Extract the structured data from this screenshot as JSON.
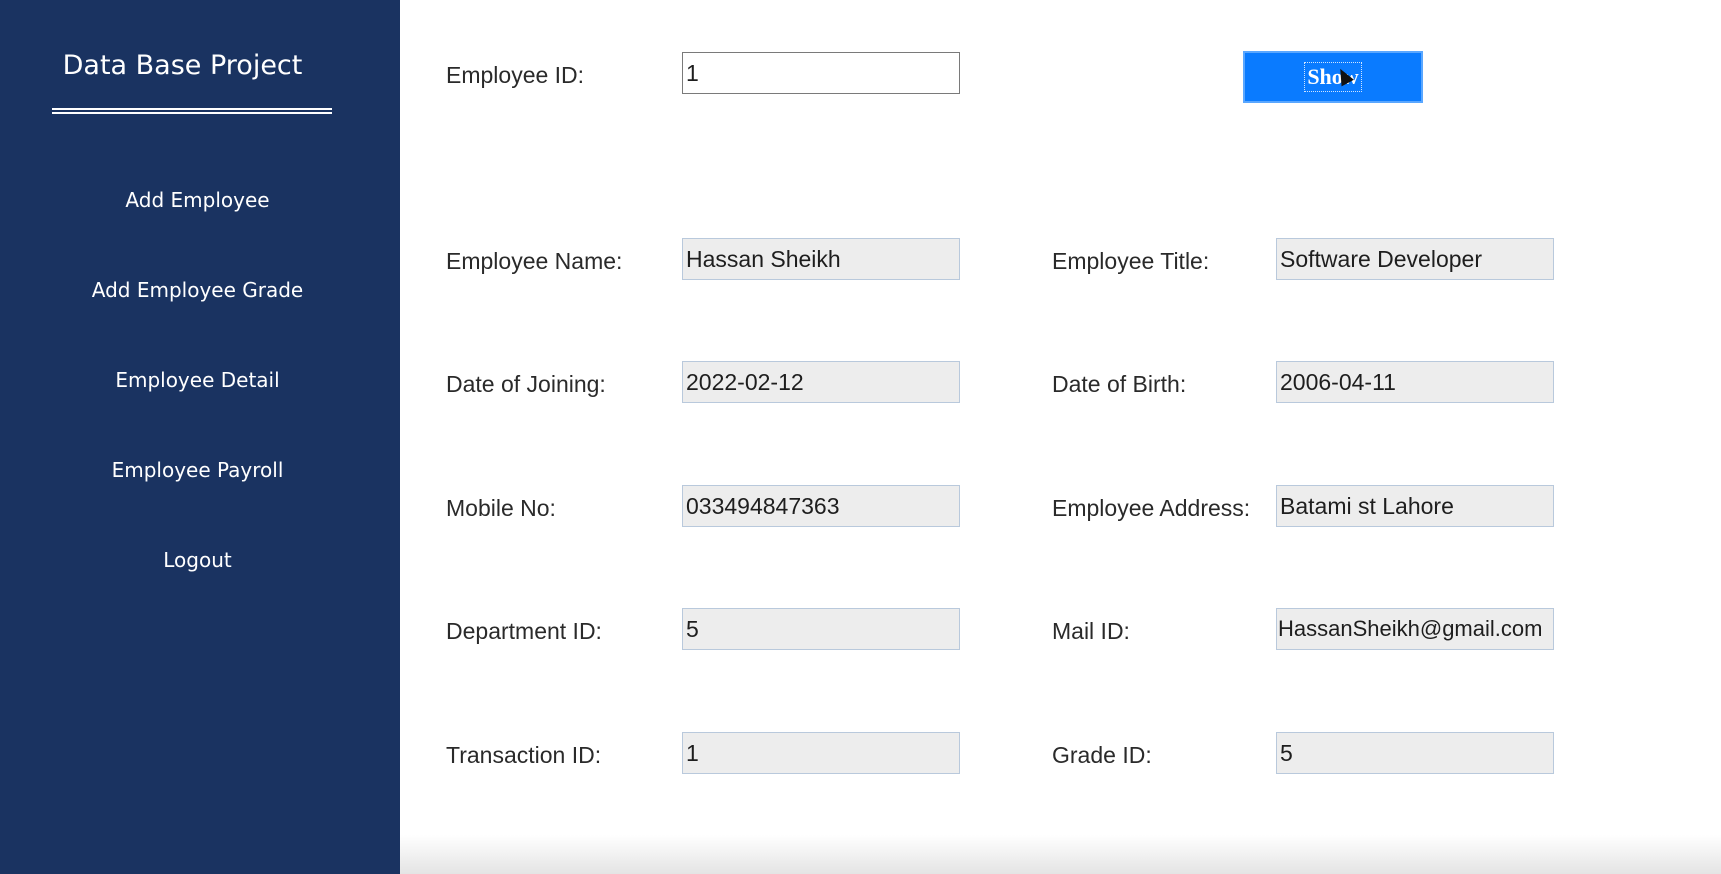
{
  "sidebar": {
    "title": "Data Base Project",
    "items": [
      {
        "label": "Add Employee"
      },
      {
        "label": "Add Employee Grade"
      },
      {
        "label": "Employee Detail"
      },
      {
        "label": "Employee Payroll"
      },
      {
        "label": "Logout"
      }
    ]
  },
  "search": {
    "label": "Employee ID:",
    "value": "1",
    "button_label": "Show"
  },
  "details": {
    "name": {
      "label": "Employee Name:",
      "value": "Hassan Sheikh"
    },
    "title": {
      "label": "Employee Title:",
      "value": "Software Developer"
    },
    "doj": {
      "label": "Date of Joining:",
      "value": "2022-02-12"
    },
    "dob": {
      "label": "Date of Birth:",
      "value": "2006-04-11"
    },
    "mobile": {
      "label": "Mobile No:",
      "value": "033494847363"
    },
    "address": {
      "label": "Employee Address:",
      "value": "Batami st Lahore"
    },
    "department": {
      "label": "Department ID:",
      "value": "5"
    },
    "mail": {
      "label": "Mail ID:",
      "value": "HassanSheikh@gmail.com"
    },
    "transaction": {
      "label": "Transaction ID:",
      "value": "1"
    },
    "grade": {
      "label": "Grade ID:",
      "value": "5"
    }
  },
  "colors": {
    "sidebar_bg": "#1a3361",
    "button_bg": "#0a7bff",
    "field_bg": "#ededed"
  }
}
